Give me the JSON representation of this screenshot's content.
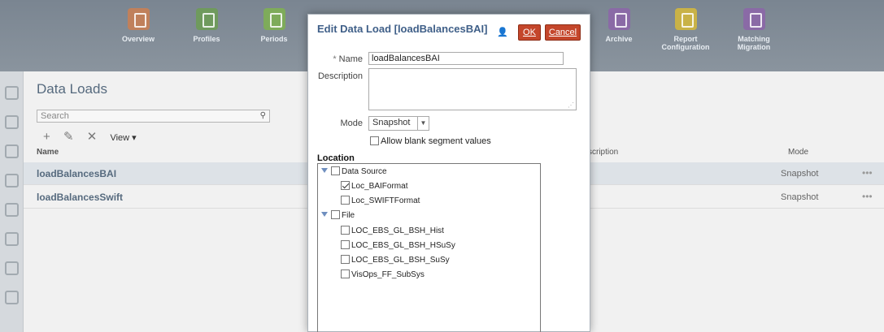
{
  "banner": {
    "tiles": [
      {
        "label": "Overview",
        "color": "#c0805b"
      },
      {
        "label": "Profiles",
        "color": "#6f9a5d"
      },
      {
        "label": "Periods",
        "color": "#7eab5a"
      },
      {
        "label": "Archive",
        "color": "#8a6aa6"
      },
      {
        "label": "Report Configuration",
        "color": "#c9b247"
      },
      {
        "label": "Matching Migration",
        "color": "#8a6aa6"
      }
    ]
  },
  "page": {
    "title": "Data Loads",
    "search_placeholder": "Search",
    "view_label": "View ▾",
    "columns": {
      "name": "Name",
      "description": "scription",
      "mode": "Mode"
    },
    "rows": [
      {
        "name": "loadBalancesBAI",
        "mode": "Snapshot"
      },
      {
        "name": "loadBalancesSwift",
        "mode": "Snapshot"
      }
    ]
  },
  "dialog": {
    "title": "Edit Data Load [loadBalancesBAI]",
    "ok_label": "OK",
    "cancel_label": "Cancel",
    "name_label": "Name",
    "name_value": "loadBalancesBAI",
    "description_label": "Description",
    "description_value": "",
    "mode_label": "Mode",
    "mode_value": "Snapshot",
    "allow_blank_label": "Allow blank segment values",
    "location_title": "Location",
    "tree": [
      {
        "label": "Data Source",
        "level": 0,
        "expanded": true,
        "checked": false
      },
      {
        "label": "Loc_BAIFormat",
        "level": 1,
        "checked": true
      },
      {
        "label": "Loc_SWIFTFormat",
        "level": 1,
        "checked": false
      },
      {
        "label": "File",
        "level": 0,
        "expanded": true,
        "checked": false
      },
      {
        "label": "LOC_EBS_GL_BSH_Hist",
        "level": 1,
        "checked": false
      },
      {
        "label": "LOC_EBS_GL_BSH_HSuSy",
        "level": 1,
        "checked": false
      },
      {
        "label": "LOC_EBS_GL_BSH_SuSy",
        "level": 1,
        "checked": false
      },
      {
        "label": "VisOps_FF_SubSys",
        "level": 1,
        "checked": false
      }
    ]
  }
}
